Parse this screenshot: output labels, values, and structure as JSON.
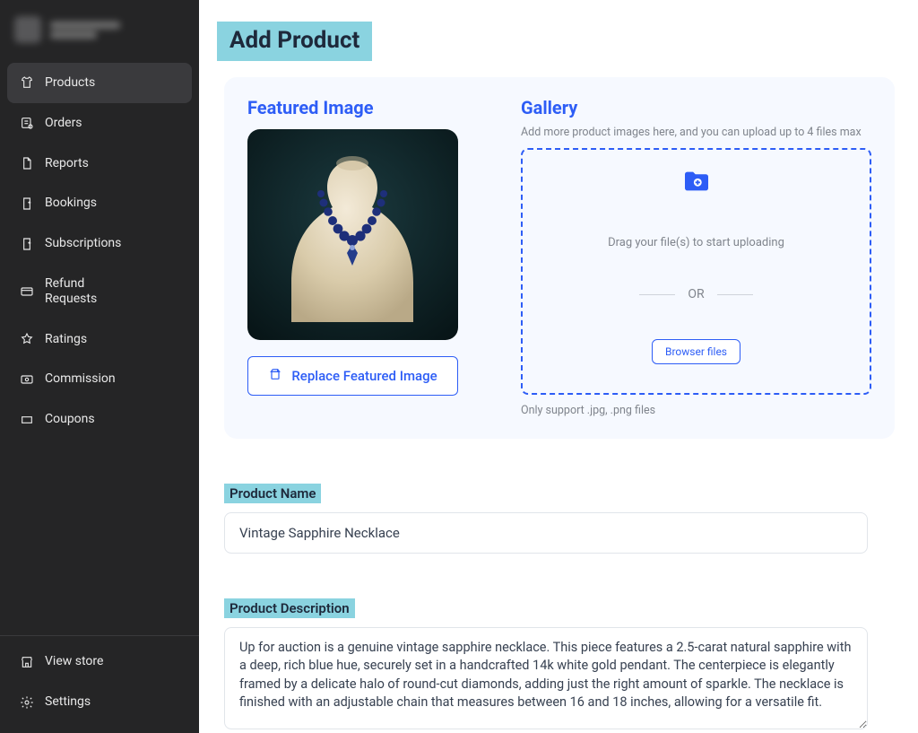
{
  "page": {
    "title": "Add Product"
  },
  "sidebar": {
    "items": [
      {
        "label": "Products"
      },
      {
        "label": "Orders"
      },
      {
        "label": "Reports"
      },
      {
        "label": "Bookings"
      },
      {
        "label": "Subscriptions"
      },
      {
        "label": "Refund Requests"
      },
      {
        "label": "Ratings"
      },
      {
        "label": "Commission"
      },
      {
        "label": "Coupons"
      }
    ],
    "footer": [
      {
        "label": "View store"
      },
      {
        "label": "Settings"
      }
    ]
  },
  "featured": {
    "title": "Featured Image",
    "replace_label": "Replace Featured Image"
  },
  "gallery": {
    "title": "Gallery",
    "hint": "Add more product images here, and you can upload up to 4 files max",
    "drag_text": "Drag your file(s) to start uploading",
    "or": "OR",
    "browse": "Browser files",
    "support": "Only support .jpg, .png files"
  },
  "form": {
    "name_label": "Product Name",
    "name_value": "Vintage Sapphire Necklace",
    "desc_label": "Product Description",
    "desc_value": "Up for auction is a genuine vintage sapphire necklace. This piece features a 2.5-carat natural sapphire with a deep, rich blue hue, securely set in a handcrafted 14k white gold pendant. The centerpiece is elegantly framed by a delicate halo of round-cut diamonds, adding just the right amount of sparkle. The necklace is finished with an adjustable chain that measures between 16 and 18 inches, allowing for a versatile fit."
  }
}
